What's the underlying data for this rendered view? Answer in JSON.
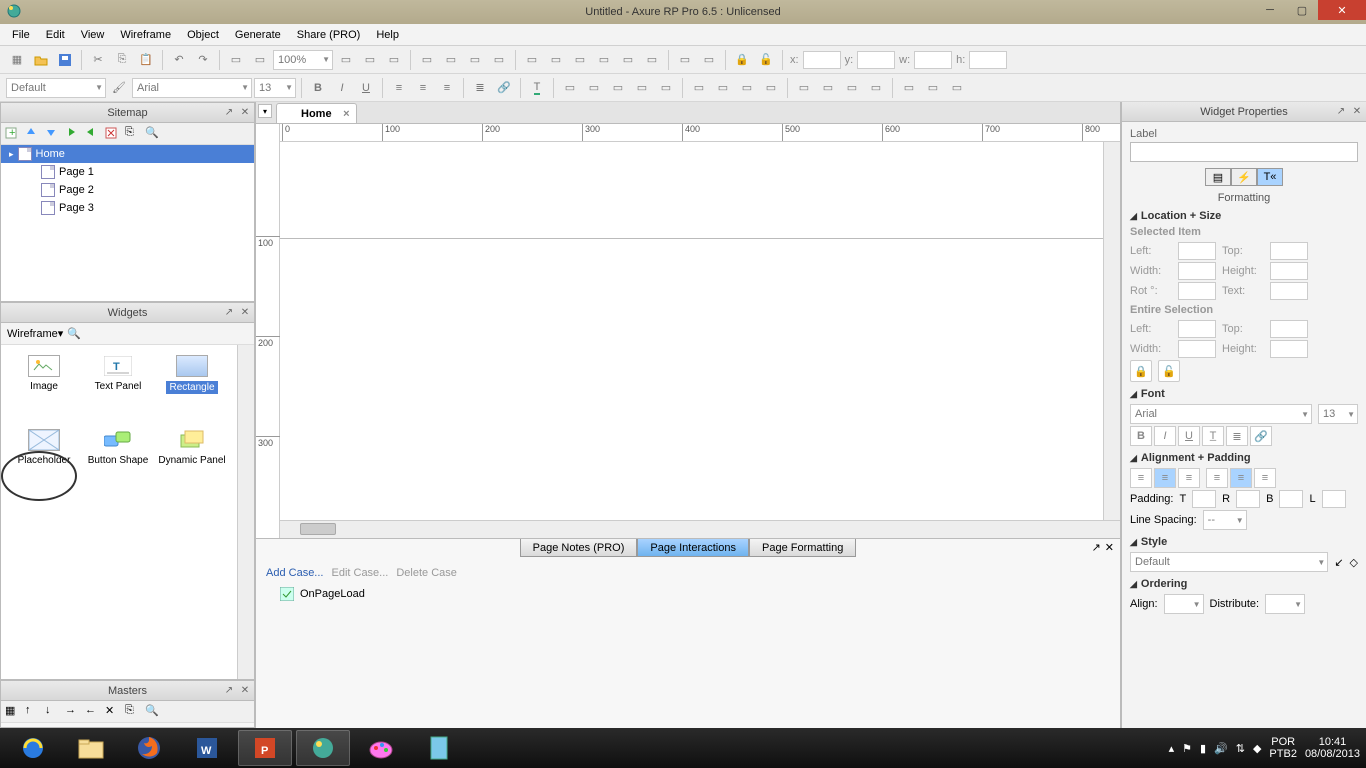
{
  "window": {
    "title": "Untitled - Axure RP Pro 6.5 : Unlicensed"
  },
  "menu": [
    "File",
    "Edit",
    "View",
    "Wireframe",
    "Object",
    "Generate",
    "Share (PRO)",
    "Help"
  ],
  "toolbar1": {
    "zoom": "100%",
    "coord_x": "",
    "coord_y": "",
    "coord_w": "",
    "coord_h": ""
  },
  "toolbar2": {
    "style": "Default",
    "font": "Arial",
    "size": "13"
  },
  "sitemap": {
    "title": "Sitemap",
    "items": [
      {
        "label": "Home",
        "selected": true,
        "children": [
          {
            "label": "Page 1"
          },
          {
            "label": "Page 2"
          },
          {
            "label": "Page 3"
          }
        ]
      }
    ]
  },
  "widgets_panel": {
    "title": "Widgets",
    "filter": "Wireframe",
    "items": [
      {
        "label": "Image"
      },
      {
        "label": "Text Panel"
      },
      {
        "label": "Rectangle",
        "selected": true
      },
      {
        "label": "Placeholder"
      },
      {
        "label": "Button Shape"
      },
      {
        "label": "Dynamic Panel"
      }
    ]
  },
  "masters_panel": {
    "title": "Masters"
  },
  "document": {
    "tab": "Home",
    "ruler_marks": [
      0,
      100,
      200,
      300,
      400,
      500,
      600,
      700,
      800
    ],
    "ruler_v": [
      100,
      200,
      300
    ]
  },
  "bottom": {
    "tabs": [
      "Page Notes (PRO)",
      "Page Interactions",
      "Page Formatting"
    ],
    "active": 1,
    "links": {
      "add": "Add Case...",
      "edit": "Edit Case...",
      "del": "Delete Case"
    },
    "event": "OnPageLoad"
  },
  "props": {
    "title": "Widget Properties",
    "label": "Label",
    "tab_label": "Formatting",
    "sections": {
      "locsize": "Location + Size",
      "selitem": "Selected Item",
      "entire": "Entire Selection",
      "font": "Font",
      "align": "Alignment + Padding",
      "style": "Style",
      "ordering": "Ordering"
    },
    "fields": {
      "left": "Left:",
      "top": "Top:",
      "width": "Width:",
      "height": "Height:",
      "rot": "Rot °:",
      "text": "Text:",
      "font_name": "Arial",
      "font_size": "13",
      "padding": "Padding:",
      "t": "T",
      "r": "R",
      "b": "B",
      "l": "L",
      "linespacing": "Line Spacing:",
      "ls_val": "--",
      "style_val": "Default",
      "align_lbl": "Align:",
      "dist_lbl": "Distribute:"
    }
  },
  "taskbar": {
    "lang": "POR",
    "kbd": "PTB2",
    "time": "10:41",
    "date": "08/08/2013"
  }
}
